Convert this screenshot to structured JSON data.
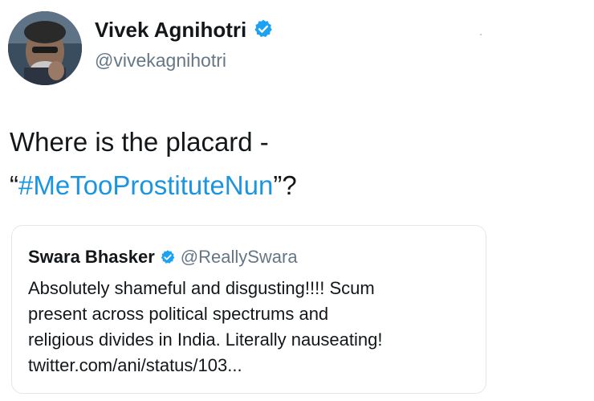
{
  "tweet": {
    "author_name": "Vivek Agnihotri",
    "author_handle": "@vivekagnihotri",
    "verified": true,
    "text_line1": "Where is the placard -",
    "text_quote_open": "“",
    "hashtag": "#MeTooProstituteNun",
    "text_quote_close": "”?"
  },
  "quoted_tweet": {
    "author_name": "Swara Bhasker",
    "author_handle": "@ReallySwara",
    "verified": true,
    "lines": [
      "Absolutely shameful and disgusting!!!! Scum",
      "present across political spectrums and",
      "religious divides in India. Literally nauseating!",
      "twitter.com/ani/status/103..."
    ]
  },
  "colors": {
    "link": "#1b95e0",
    "verified_badge": "#1da1f2",
    "secondary_text": "#657786",
    "border": "#e1e8ed"
  },
  "icons": {
    "verified": "verified-badge-icon"
  }
}
